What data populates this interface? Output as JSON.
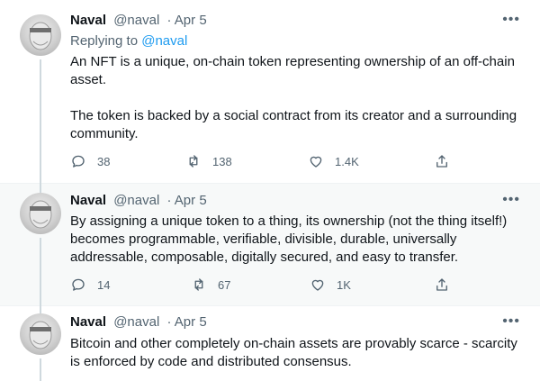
{
  "tweets": [
    {
      "author": "Naval",
      "handle": "@naval",
      "date": "· Apr 5",
      "replying_prefix": "Replying to ",
      "replying_to": "@naval",
      "paragraphs": [
        "An NFT is a unique, on-chain token representing ownership of an off-chain asset.",
        "The token is backed by a social contract from its creator and a surrounding community."
      ],
      "replies": "38",
      "retweets": "138",
      "likes": "1.4K",
      "more": "•••"
    },
    {
      "author": "Naval",
      "handle": "@naval",
      "date": "· Apr 5",
      "paragraphs": [
        "By assigning a unique token to a thing, its ownership (not the thing itself!) becomes programmable, verifiable, divisible, durable, universally addressable, composable, digitally secured, and easy to transfer."
      ],
      "replies": "14",
      "retweets": "67",
      "likes": "1K",
      "more": "•••"
    },
    {
      "author": "Naval",
      "handle": "@naval",
      "date": "· Apr 5",
      "paragraphs": [
        "Bitcoin and other completely on-chain assets are provably scarce - scarcity is enforced by code and distributed consensus."
      ],
      "more": "•••"
    }
  ],
  "icons": {
    "reply": "comment-bubble-icon",
    "retweet": "retweet-arrows-icon",
    "like": "heart-outline-icon",
    "share": "share-upload-icon",
    "more": "more-dots-icon"
  },
  "colors": {
    "text": "#0f1419",
    "secondary": "#536471",
    "link": "#1d9bf0",
    "highlight_bg": "#f7f9f9",
    "thread_line": "#cfd9de"
  }
}
